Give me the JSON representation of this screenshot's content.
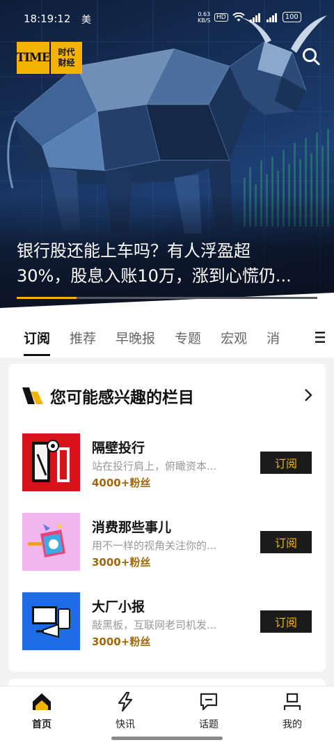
{
  "status_bar": {
    "time": "18:19:12",
    "carrier": "美",
    "net_speed": "0.63",
    "net_unit": "KB/S",
    "hd": "HD",
    "battery": "100"
  },
  "header": {
    "logo_mark": "TIME",
    "logo_text_line1": "时代",
    "logo_text_line2": "财经",
    "search_icon": "search-icon"
  },
  "hero": {
    "title_line1": "银行股还能上车吗？有人浮盈超",
    "title_line2": "30%，股息入账10万，涨到心慌仍...",
    "progress_fraction": 0.2,
    "colors": {
      "accent": "#f2b400"
    }
  },
  "tabs": {
    "items": [
      {
        "label": "订阅"
      },
      {
        "label": "推荐"
      },
      {
        "label": "早晚报"
      },
      {
        "label": "专题"
      },
      {
        "label": "宏观"
      },
      {
        "label": "消"
      }
    ],
    "active_index": 0,
    "menu_icon": "menu-icon"
  },
  "recommend": {
    "title": "您可能感兴趣的栏目",
    "items": [
      {
        "name": "隔壁投行",
        "desc": "站在投行肩上，俯瞰资本...",
        "fans": "4000+粉丝",
        "button": "订阅"
      },
      {
        "name": "消费那些事儿",
        "desc": "用不一样的视角关注你的...",
        "fans": "3000+粉丝",
        "button": "订阅"
      },
      {
        "name": "大厂小报",
        "desc": "敲黑板，互联网老司机发...",
        "fans": "3000+粉丝",
        "button": "订阅"
      }
    ]
  },
  "bottom_nav": {
    "items": [
      {
        "label": "首页",
        "icon": "home-icon"
      },
      {
        "label": "快讯",
        "icon": "lightning-icon"
      },
      {
        "label": "话题",
        "icon": "chat-icon"
      },
      {
        "label": "我的",
        "icon": "profile-icon"
      }
    ],
    "active_index": 0
  }
}
